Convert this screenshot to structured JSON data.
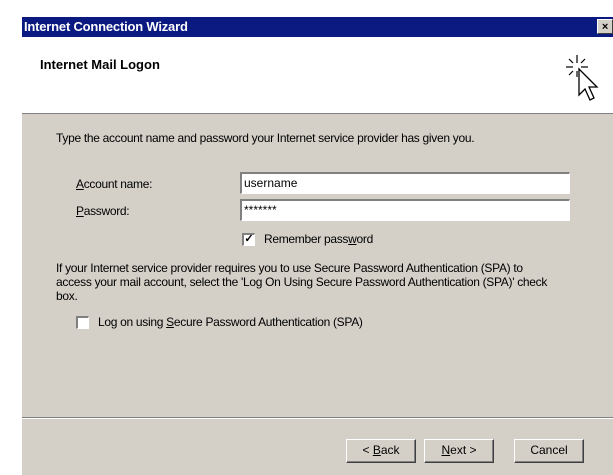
{
  "window": {
    "title": "Internet Connection Wizard",
    "close_glyph": "×"
  },
  "header": {
    "title": "Internet Mail Logon",
    "icon": "wizard-cursor-icon"
  },
  "intro_text": "Type the account name and password your Internet service provider has given you.",
  "fields": {
    "account_name": {
      "label_accel": "A",
      "label_rest": "ccount name:",
      "value": "username"
    },
    "password": {
      "label_accel": "P",
      "label_rest": "assword:",
      "value": "*******"
    }
  },
  "remember_password": {
    "checked": true,
    "check_glyph": "✓",
    "label_pre": "Remember pass",
    "label_accel": "w",
    "label_post": "ord"
  },
  "spa_paragraph": "If your Internet service provider requires you to use Secure Password Authentication (SPA) to access your mail account, select the 'Log On Using Secure Password Authentication (SPA)' check box.",
  "spa_checkbox": {
    "checked": false,
    "label_pre": "Log on using ",
    "label_accel": "S",
    "label_post": "ecure Password Authentication (SPA)"
  },
  "buttons": {
    "back": {
      "prefix": "< ",
      "accel": "B",
      "rest": "ack"
    },
    "next": {
      "accel": "N",
      "rest": "ext >"
    },
    "cancel": {
      "label": "Cancel"
    }
  }
}
